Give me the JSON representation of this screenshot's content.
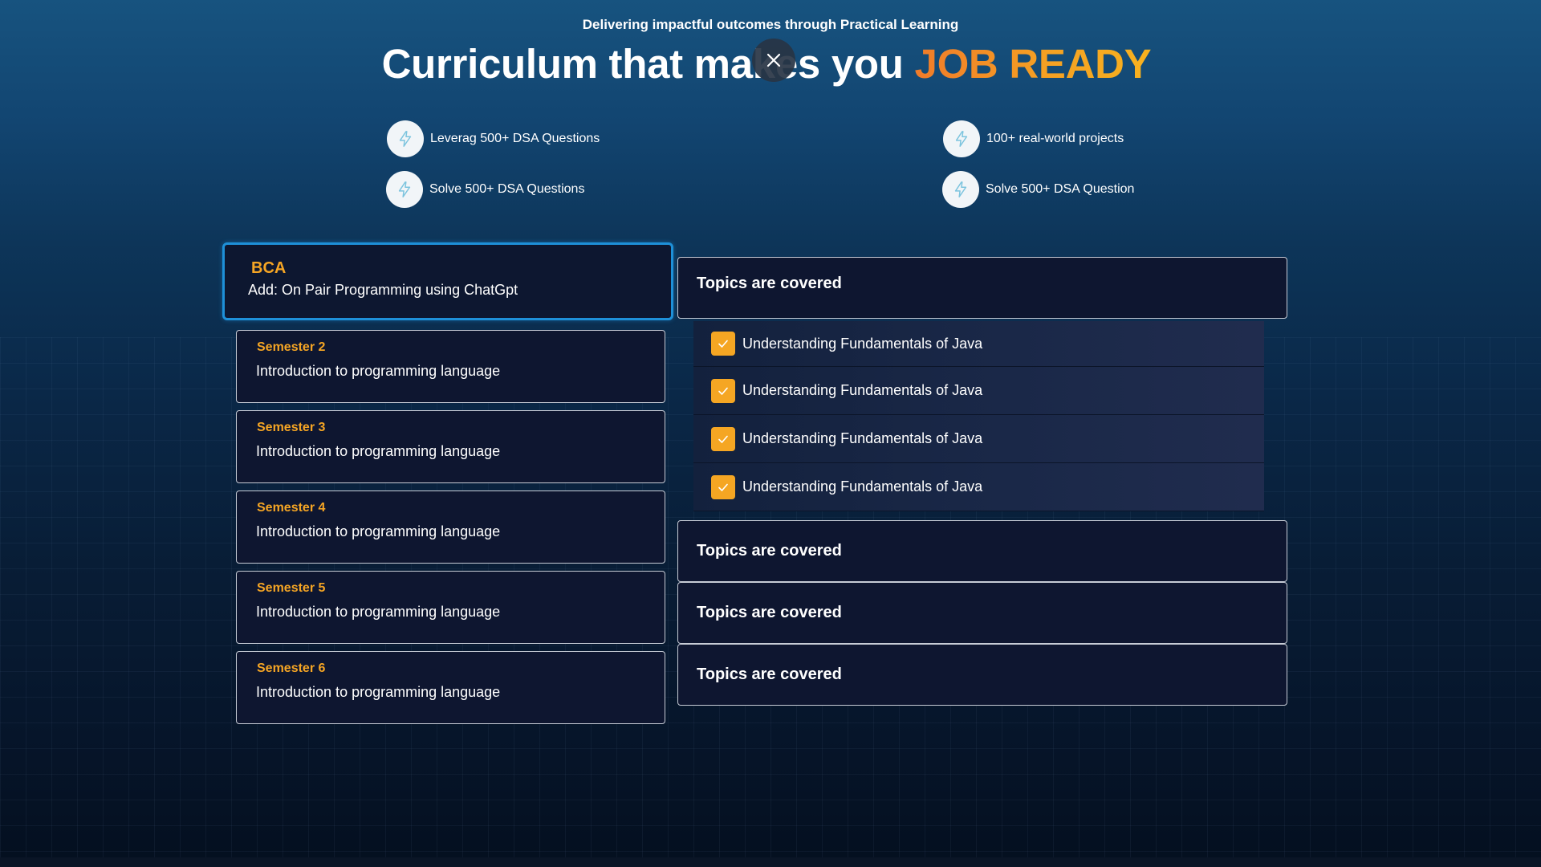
{
  "hero": {
    "tagline": "Delivering impactful outcomes through Practical Learning",
    "headline_part1": "Curriculum that makes you ",
    "headline_accent": "JOB READY"
  },
  "features": [
    {
      "label": "Leverag 500+ DSA Questions",
      "icon": "lightning-icon"
    },
    {
      "label": "100+ real-world projects",
      "icon": "lightning-icon"
    },
    {
      "label": "Solve 500+ DSA Questions",
      "icon": "lightning-icon"
    },
    {
      "label": "Solve 500+ DSA Question",
      "icon": "lightning-icon"
    }
  ],
  "program": {
    "title": "BCA",
    "subtitle": "Add: On Pair Programming using ChatGpt"
  },
  "semesters": [
    {
      "title": "Semester 2",
      "description": "Introduction to programming language"
    },
    {
      "title": "Semester 3",
      "description": "Introduction to programming language"
    },
    {
      "title": "Semester 4",
      "description": "Introduction to programming language"
    },
    {
      "title": "Semester 5",
      "description": "Introduction to programming language"
    },
    {
      "title": "Semester 6",
      "description": "Introduction to programming language"
    }
  ],
  "topic_sections": [
    {
      "label": "Topics are covered",
      "expanded": true
    },
    {
      "label": "Topics are covered",
      "expanded": false
    },
    {
      "label": "Topics are covered",
      "expanded": false
    },
    {
      "label": "Topics are covered",
      "expanded": false
    }
  ],
  "topics": [
    {
      "label": "Understanding Fundamentals of Java",
      "checked": true
    },
    {
      "label": "Understanding Fundamentals of Java",
      "checked": true
    },
    {
      "label": "Understanding Fundamentals of Java",
      "checked": true
    },
    {
      "label": "Understanding Fundamentals of Java",
      "checked": true
    }
  ],
  "colors": {
    "accent_orange": "#f5a524",
    "highlight_border": "#1e90d8",
    "card_background": "#0e1630"
  }
}
